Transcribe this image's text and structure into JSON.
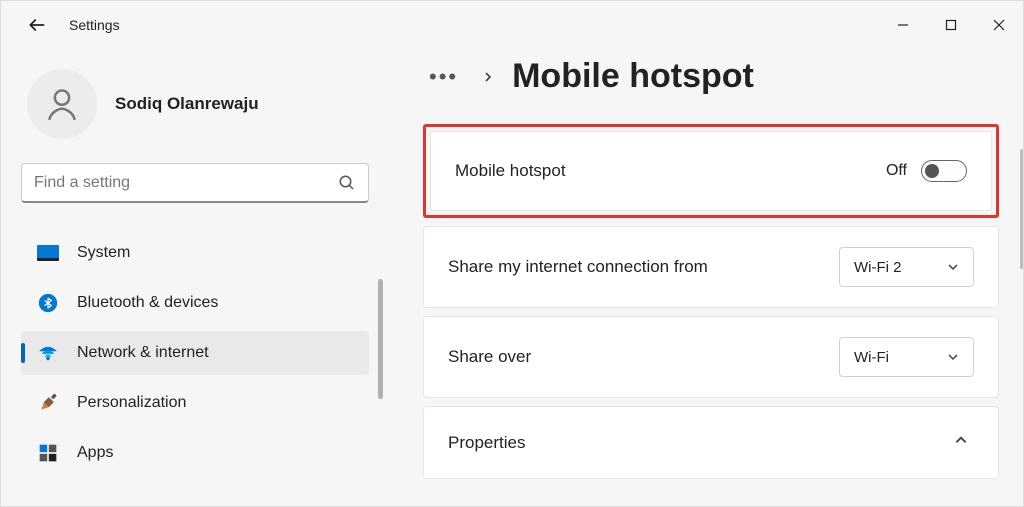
{
  "titlebar": {
    "app_name": "Settings"
  },
  "profile": {
    "username": "Sodiq Olanrewaju"
  },
  "search": {
    "placeholder": "Find a setting"
  },
  "sidebar": {
    "items": [
      {
        "label": "System"
      },
      {
        "label": "Bluetooth & devices"
      },
      {
        "label": "Network & internet"
      },
      {
        "label": "Personalization"
      },
      {
        "label": "Apps"
      }
    ]
  },
  "breadcrumb": {
    "title": "Mobile hotspot"
  },
  "cards": {
    "hotspot": {
      "label": "Mobile hotspot",
      "state": "Off"
    },
    "share_from": {
      "label": "Share my internet connection from",
      "value": "Wi-Fi 2"
    },
    "share_over": {
      "label": "Share over",
      "value": "Wi-Fi"
    },
    "properties": {
      "label": "Properties"
    }
  }
}
